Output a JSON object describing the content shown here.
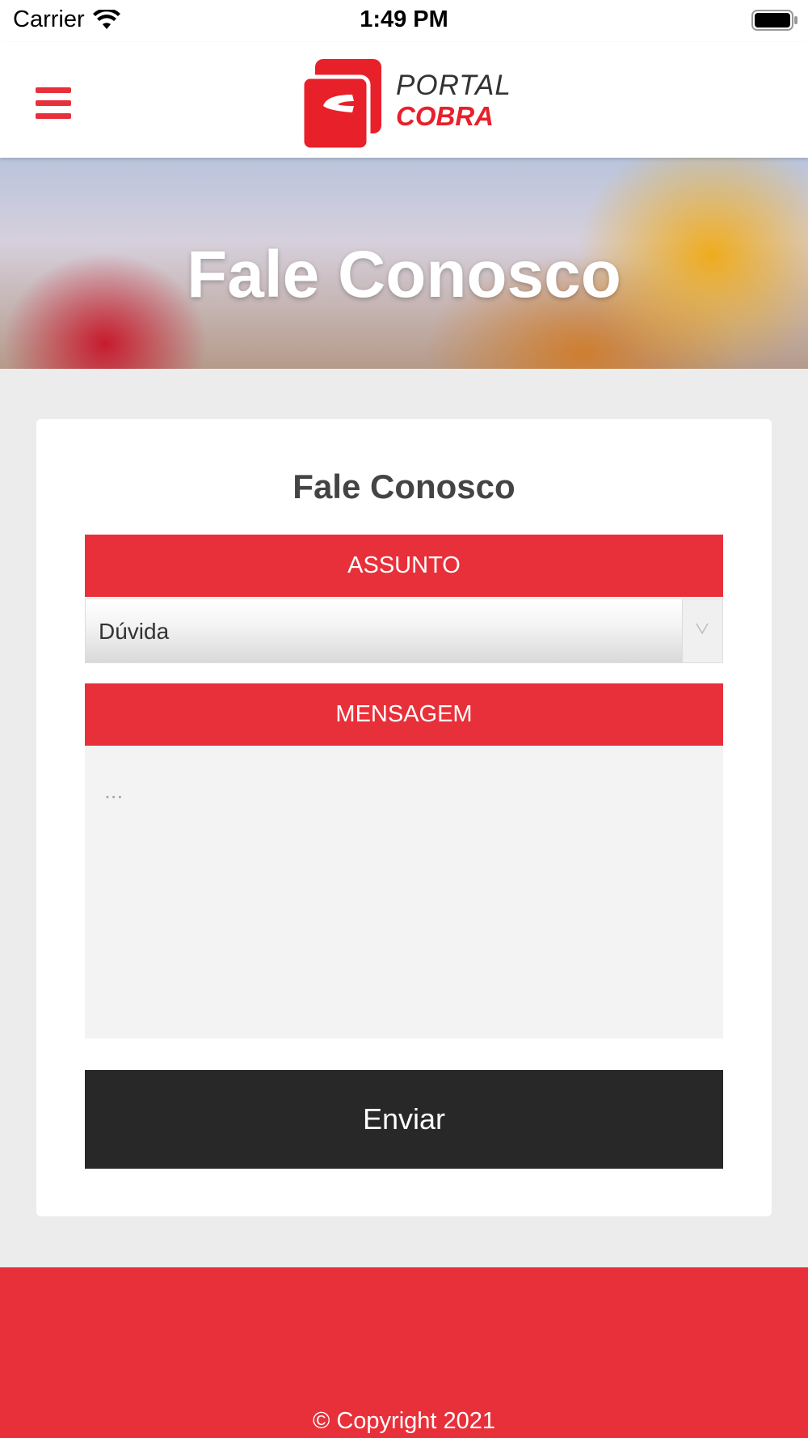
{
  "status_bar": {
    "carrier": "Carrier",
    "time": "1:49 PM"
  },
  "header": {
    "logo_line1": "PORTAL",
    "logo_line2": "COBRA",
    "menu_icon": "hamburger-menu-icon"
  },
  "hero": {
    "title": "Fale Conosco"
  },
  "form": {
    "title": "Fale Conosco",
    "subject_label": "ASSUNTO",
    "subject_value": "Dúvida",
    "message_label": "MENSAGEM",
    "message_placeholder": "...",
    "submit_label": "Enviar"
  },
  "footer": {
    "copyright": "© Copyright 2021"
  },
  "colors": {
    "brand_red": "#e8303a",
    "button_dark": "#282828"
  }
}
